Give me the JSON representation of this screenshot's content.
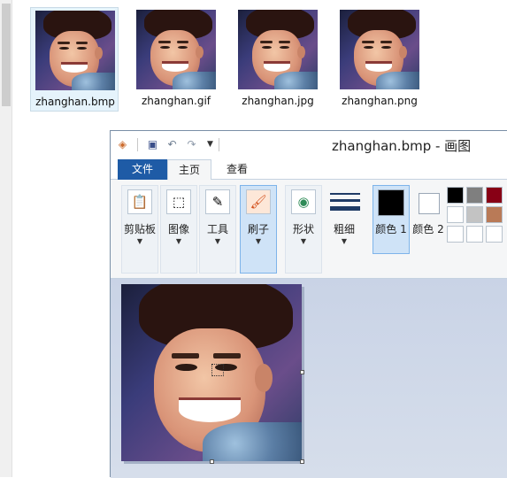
{
  "files": [
    {
      "name": "zhanghan.bmp",
      "selected": true
    },
    {
      "name": "zhanghan.gif",
      "selected": false
    },
    {
      "name": "zhanghan.jpg",
      "selected": false
    },
    {
      "name": "zhanghan.png",
      "selected": false
    }
  ],
  "paint": {
    "window_title": "zhanghan.bmp - 画图",
    "quick_access": {
      "icons": [
        "paint-app-icon",
        "save-icon",
        "undo-icon",
        "redo-icon",
        "customize-dropdown-icon"
      ]
    },
    "tabs": {
      "file": "文件",
      "home": "主页",
      "view": "查看"
    },
    "ribbon": {
      "clipboard": "剪贴板",
      "image": "图像",
      "tools": "工具",
      "brushes": "刷子",
      "shapes": "形状",
      "size": "粗细",
      "color1": "颜色 1",
      "color2": "颜色 2"
    },
    "colors": {
      "color1": "#000000",
      "color2": "#ffffff",
      "palette_row1": [
        "#000000",
        "#7f7f7f",
        "#880015"
      ],
      "palette_row2": [
        "#ffffff",
        "#c3c3c3",
        "#b97a57"
      ],
      "palette_row3": [
        "#ffffff",
        "#ffffff",
        "#ffffff"
      ],
      "accent": "#1e5ba6"
    }
  }
}
